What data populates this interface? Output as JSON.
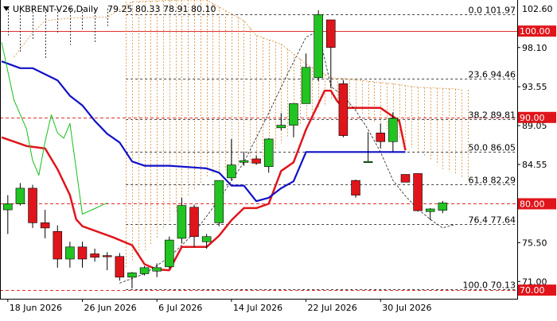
{
  "chart_data": {
    "type": "candlestick",
    "header": {
      "symbol_timeframe": "UKBRENT-V26,Daily",
      "ohlc": "79.25 80.33 78.91 80.10"
    },
    "y_axis": {
      "range": [
        69.0,
        103.6
      ],
      "tick_labels": [
        "98.10",
        "93.55",
        "89.05",
        "84.55",
        "75.50",
        "71.00"
      ],
      "tick_values": [
        98.1,
        93.55,
        89.05,
        84.55,
        75.5,
        71.0
      ],
      "price_badges": [
        {
          "text": "102.60",
          "value": 102.6,
          "style": "plain"
        },
        {
          "text": "100.00",
          "value": 100.0,
          "style": "red"
        },
        {
          "text": "90.00",
          "value": 90.0,
          "style": "red"
        },
        {
          "text": "80.00",
          "value": 80.0,
          "style": "red"
        },
        {
          "text": "70.00",
          "value": 70.0,
          "style": "red"
        }
      ]
    },
    "x_axis": {
      "date_labels": [
        {
          "text": "18 Jun 2026",
          "index": 0
        },
        {
          "text": "26 Jun 2026",
          "index": 6
        },
        {
          "text": "6 Jul 2026",
          "index": 12
        },
        {
          "text": "14 Jul 2026",
          "index": 18
        },
        {
          "text": "22 Jul 2026",
          "index": 24
        },
        {
          "text": "30 Jul 2026",
          "index": 30
        }
      ],
      "first_index": -0.5,
      "last_index": 41
    },
    "horizontal_levels": [
      {
        "value": 100.0,
        "color": "#e03030",
        "style": "solid"
      },
      {
        "value": 90.0,
        "color": "#e03030",
        "style": "dash"
      },
      {
        "value": 80.0,
        "color": "#e03030",
        "style": "dash"
      },
      {
        "value": 70.0,
        "color": "#e03030",
        "style": "dash"
      }
    ],
    "fibonacci": {
      "x_start": 9.5,
      "levels": [
        {
          "label": "0.0 101.97",
          "value": 101.97
        },
        {
          "label": "23.6 94.46",
          "value": 94.46
        },
        {
          "label": "38.2 89.81",
          "value": 89.81
        },
        {
          "label": "50.0 86.05",
          "value": 86.05
        },
        {
          "label": "61.8 82.29",
          "value": 82.29
        },
        {
          "label": "76.4 77.64",
          "value": 77.64
        },
        {
          "label": "100.0 70.13",
          "value": 70.13
        }
      ]
    },
    "candles": [
      {
        "o": 79.3,
        "h": 81.0,
        "l": 76.5,
        "c": 80.0
      },
      {
        "o": 80.0,
        "h": 82.4,
        "l": 79.8,
        "c": 81.8
      },
      {
        "o": 81.8,
        "h": 82.2,
        "l": 77.2,
        "c": 77.8
      },
      {
        "o": 77.8,
        "h": 79.3,
        "l": 76.0,
        "c": 77.2
      },
      {
        "o": 76.8,
        "h": 77.5,
        "l": 72.6,
        "c": 73.6
      },
      {
        "o": 73.6,
        "h": 75.6,
        "l": 72.6,
        "c": 75.0
      },
      {
        "o": 75.0,
        "h": 75.6,
        "l": 72.6,
        "c": 73.6
      },
      {
        "o": 74.2,
        "h": 74.8,
        "l": 73.3,
        "c": 73.8
      },
      {
        "o": 74.0,
        "h": 74.4,
        "l": 72.3,
        "c": 73.9
      },
      {
        "o": 73.9,
        "h": 74.3,
        "l": 71.1,
        "c": 71.5
      },
      {
        "o": 71.5,
        "h": 72.1,
        "l": 70.2,
        "c": 72.0
      },
      {
        "o": 71.9,
        "h": 72.8,
        "l": 71.7,
        "c": 72.6
      },
      {
        "o": 72.2,
        "h": 73.1,
        "l": 71.5,
        "c": 72.6
      },
      {
        "o": 72.7,
        "h": 76.2,
        "l": 72.5,
        "c": 75.8
      },
      {
        "o": 76.0,
        "h": 80.7,
        "l": 75.4,
        "c": 79.8
      },
      {
        "o": 79.6,
        "h": 79.9,
        "l": 75.0,
        "c": 76.2
      },
      {
        "o": 75.6,
        "h": 76.5,
        "l": 74.8,
        "c": 76.2
      },
      {
        "o": 77.8,
        "h": 82.7,
        "l": 77.4,
        "c": 82.7
      },
      {
        "o": 83.0,
        "h": 87.5,
        "l": 82.7,
        "c": 84.5
      },
      {
        "o": 84.8,
        "h": 86.0,
        "l": 84.4,
        "c": 85.0
      },
      {
        "o": 85.2,
        "h": 85.6,
        "l": 84.5,
        "c": 84.7
      },
      {
        "o": 84.3,
        "h": 87.6,
        "l": 83.6,
        "c": 87.5
      },
      {
        "o": 88.8,
        "h": 90.5,
        "l": 88.5,
        "c": 89.1
      },
      {
        "o": 89.1,
        "h": 91.6,
        "l": 87.7,
        "c": 91.6
      },
      {
        "o": 91.6,
        "h": 97.4,
        "l": 91.6,
        "c": 95.8
      },
      {
        "o": 94.6,
        "h": 102.4,
        "l": 94.2,
        "c": 101.9
      },
      {
        "o": 101.3,
        "h": 101.3,
        "l": 93.4,
        "c": 98.1
      },
      {
        "o": 93.9,
        "h": 94.3,
        "l": 87.7,
        "c": 87.9
      },
      {
        "o": 82.7,
        "h": 82.8,
        "l": 80.7,
        "c": 81.0
      },
      {
        "o": 84.8,
        "h": 88.3,
        "l": 84.8,
        "c": 84.9
      },
      {
        "o": 88.2,
        "h": 89.3,
        "l": 86.4,
        "c": 87.2
      },
      {
        "o": 87.2,
        "h": 90.6,
        "l": 86.0,
        "c": 89.9
      },
      {
        "o": 83.4,
        "h": 83.4,
        "l": 82.5,
        "c": 82.5
      },
      {
        "o": 83.5,
        "h": 83.5,
        "l": 79.1,
        "c": 79.2
      },
      {
        "o": 79.1,
        "h": 79.5,
        "l": 78.1,
        "c": 79.4
      },
      {
        "o": 79.25,
        "h": 80.33,
        "l": 78.91,
        "c": 80.1
      }
    ],
    "candle_colors": {
      "up": "#22c422",
      "down": "#e0151b"
    },
    "lines": [
      {
        "color": "#e0151b",
        "width": 2.5,
        "dash": "",
        "points": [
          [
            -0.5,
            87.7
          ],
          [
            1.5,
            86.7
          ],
          [
            3,
            86.4
          ],
          [
            4,
            84.0
          ],
          [
            5,
            81.0
          ],
          [
            5.5,
            78.2
          ],
          [
            6,
            77.4
          ],
          [
            8.5,
            76.1
          ],
          [
            10,
            75.2
          ],
          [
            11,
            73.0
          ],
          [
            12,
            72.4
          ],
          [
            13,
            72.3
          ],
          [
            14,
            75.0
          ],
          [
            16,
            75.0
          ],
          [
            17,
            76.3
          ],
          [
            18,
            78.1
          ],
          [
            19,
            79.5
          ],
          [
            20,
            79.5
          ],
          [
            21,
            80.0
          ],
          [
            22,
            83.8
          ],
          [
            23,
            84.8
          ],
          [
            24,
            88.6
          ],
          [
            25,
            91.6
          ],
          [
            25.5,
            93.1
          ],
          [
            26,
            93.1
          ],
          [
            26.5,
            91.9
          ],
          [
            27,
            91.1
          ],
          [
            30,
            91.1
          ],
          [
            31,
            90.1
          ],
          [
            31.5,
            89.6
          ],
          [
            32,
            86.2
          ]
        ]
      },
      {
        "color": "#1010c8",
        "width": 2.2,
        "dash": "",
        "points": [
          [
            -0.5,
            96.5
          ],
          [
            1,
            95.7
          ],
          [
            2,
            95.7
          ],
          [
            4,
            94.3
          ],
          [
            5,
            92.5
          ],
          [
            6,
            91.4
          ],
          [
            7,
            89.6
          ],
          [
            8,
            88.1
          ],
          [
            9,
            87.1
          ],
          [
            10,
            84.9
          ],
          [
            11,
            84.4
          ],
          [
            12,
            84.4
          ],
          [
            13,
            84.4
          ],
          [
            16,
            84.1
          ],
          [
            17,
            83.6
          ],
          [
            18,
            82.1
          ],
          [
            19,
            82.1
          ],
          [
            20,
            80.3
          ],
          [
            21,
            80.7
          ],
          [
            22,
            81.8
          ],
          [
            23,
            82.6
          ],
          [
            24,
            86.0
          ],
          [
            32,
            86.0
          ]
        ]
      },
      {
        "color": "#18c018",
        "width": 1,
        "dash": "",
        "points": [
          [
            -0.5,
            98.7
          ],
          [
            0.5,
            92.0
          ],
          [
            1.5,
            88.7
          ],
          [
            2,
            85.0
          ],
          [
            2.5,
            83.3
          ],
          [
            3,
            87.2
          ],
          [
            3.5,
            90.3
          ],
          [
            4,
            88.2
          ],
          [
            4.5,
            87.6
          ],
          [
            5,
            89.3
          ],
          [
            6,
            78.8
          ],
          [
            8,
            80.1
          ]
        ]
      },
      {
        "color": "#202020",
        "width": 0.8,
        "dash": "3,2",
        "points": [
          [
            9,
            70.8
          ],
          [
            11,
            71.9
          ],
          [
            13,
            73.8
          ],
          [
            15,
            76.6
          ],
          [
            17,
            80.5
          ],
          [
            19,
            84.8
          ],
          [
            21,
            90.5
          ],
          [
            22.5,
            95.0
          ],
          [
            24,
            99.3
          ],
          [
            25,
            100.0
          ],
          [
            26,
            93.6
          ],
          [
            27,
            92.5
          ],
          [
            28,
            90.8
          ],
          [
            29,
            88.6
          ],
          [
            30,
            86.0
          ],
          [
            31,
            82.7
          ],
          [
            32,
            80.9
          ],
          [
            33,
            79.4
          ],
          [
            34,
            78.2
          ],
          [
            35,
            77.2
          ],
          [
            36,
            77.6
          ]
        ]
      },
      {
        "color": "#d89040",
        "width": 0.8,
        "dash": "2,2",
        "points": [
          [
            0.5,
            97.0
          ],
          [
            2,
            99.8
          ],
          [
            3,
            101.2
          ],
          [
            5,
            101.5
          ],
          [
            7,
            101.6
          ],
          [
            8,
            101.6
          ],
          [
            10,
            103.4
          ],
          [
            14,
            103.6
          ],
          [
            16,
            103.6
          ],
          [
            19,
            101.2
          ],
          [
            20,
            99.5
          ],
          [
            22,
            98.5
          ],
          [
            24,
            96.2
          ],
          [
            26,
            94.6
          ],
          [
            27,
            94.5
          ],
          [
            29,
            94.2
          ],
          [
            31,
            93.9
          ],
          [
            33,
            93.5
          ],
          [
            36,
            93.3
          ],
          [
            36.5,
            93.2
          ]
        ]
      }
    ],
    "cloud": {
      "color": "#d89040",
      "from": 9.5,
      "to": 37,
      "upper": [
        [
          9.5,
          103.4
        ],
        [
          14,
          103.6
        ],
        [
          16,
          103.6
        ],
        [
          19,
          101.2
        ],
        [
          20,
          99.5
        ],
        [
          22,
          98.5
        ],
        [
          24,
          96.2
        ],
        [
          26,
          94.6
        ],
        [
          27,
          94.5
        ],
        [
          29,
          94.2
        ],
        [
          31,
          93.9
        ],
        [
          33,
          93.5
        ],
        [
          37,
          93.2
        ]
      ],
      "lower": [
        [
          9.5,
          72.5
        ],
        [
          12,
          76.0
        ],
        [
          14,
          80.0
        ],
        [
          16,
          83.0
        ],
        [
          18,
          84.2
        ],
        [
          20,
          84.6
        ],
        [
          22,
          87.0
        ],
        [
          24,
          90.0
        ],
        [
          26,
          92.0
        ],
        [
          27,
          91.5
        ],
        [
          29,
          90.0
        ],
        [
          31,
          88.0
        ],
        [
          33,
          86.0
        ],
        [
          35,
          84.0
        ],
        [
          37,
          82.8
        ]
      ]
    },
    "fractal_lines": {
      "color": "#333333",
      "x": [
        0,
        1,
        2,
        3,
        4,
        5,
        6,
        7,
        8
      ],
      "top": 102.6,
      "bottom_values": [
        99.5,
        97.5,
        99.0,
        96.8,
        99.8,
        98.4,
        100.2,
        98.6,
        100.6
      ]
    }
  }
}
